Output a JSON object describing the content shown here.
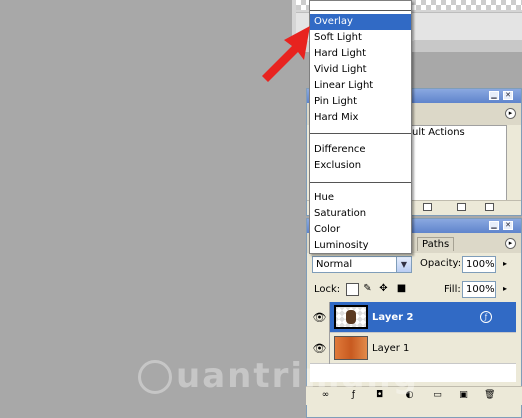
{
  "blend_menu": {
    "items": [
      "Overlay",
      "Soft Light",
      "Hard Light",
      "Vivid Light",
      "Linear Light",
      "Pin Light",
      "Hard Mix",
      "Difference",
      "Exclusion",
      "Hue",
      "Saturation",
      "Color",
      "Luminosity"
    ],
    "selected": "Overlay"
  },
  "actions_panel": {
    "list_item": "ult Actions"
  },
  "layers_panel": {
    "tab_paths": "Paths",
    "blend_mode": "Normal",
    "opacity_label": "Opacity:",
    "opacity_value": "100%",
    "lock_label": "Lock:",
    "fill_label": "Fill:",
    "fill_value": "100%",
    "layers": [
      {
        "name": "Layer 2",
        "selected": true
      },
      {
        "name": "Layer 1",
        "selected": false
      }
    ]
  },
  "watermark": "uantrimang",
  "icons": {
    "arrow": "red-pointer-arrow",
    "eye": "eye-icon",
    "menu": "panel-menu-icon"
  },
  "colors": {
    "selection": "#316ac5",
    "arrow": "#e8231f",
    "panel": "#ece9d8"
  }
}
